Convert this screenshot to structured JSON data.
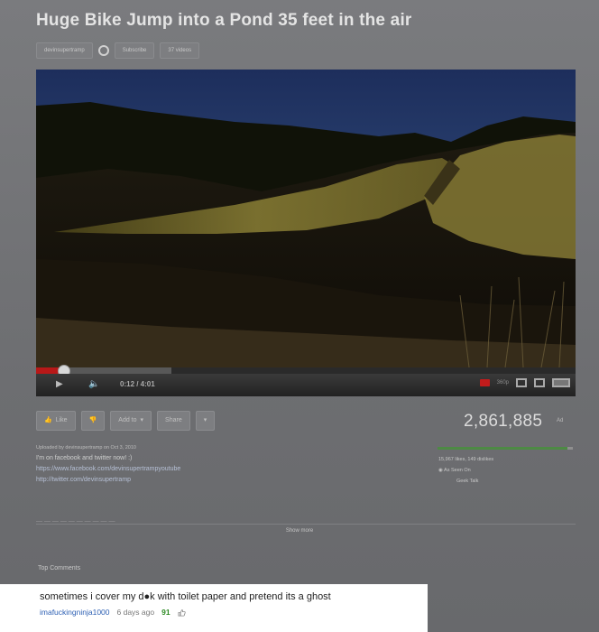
{
  "video": {
    "title": "Huge Bike Jump into a Pond 35 feet in the air",
    "channel": "devinsupertramp",
    "subscribe_label": "Subscribe",
    "videos_count": "37 videos",
    "time": "0:12 / 4:01",
    "progress_fraction": 0.05,
    "buffered_fraction": 0.25,
    "quality": "360p"
  },
  "actions": {
    "like_label": "Like",
    "add_label": "Add to",
    "share_label": "Share"
  },
  "stats": {
    "views": "2,861,885",
    "views_tag": "Ad",
    "likes_dislikes": "15,967 likes, 149 dislikes",
    "as_seen_on": "As Seen On",
    "geek_talk": "Geek Talk",
    "like_fraction": 0.96
  },
  "description": {
    "uploaded": "Uploaded by devinsupertramp on Oct 3, 2010",
    "line1": "I'm on facebook and twitter now! :)",
    "facebook": "https://www.facebook.com/devinsupertrampyoutube",
    "twitter": "http://twitter.com/devinsupertramp",
    "show_more": "Show more"
  },
  "comments": {
    "header": "Top Comments",
    "top": {
      "text": "sometimes i cover my d●k with toilet paper and pretend its a ghost",
      "user": "imafuckingninja1000",
      "age": "6 days ago",
      "likes": "91"
    }
  },
  "colors": {
    "link": "#2c5fb3",
    "likes_green": "#2d8a23",
    "progress_red": "#b81818"
  }
}
